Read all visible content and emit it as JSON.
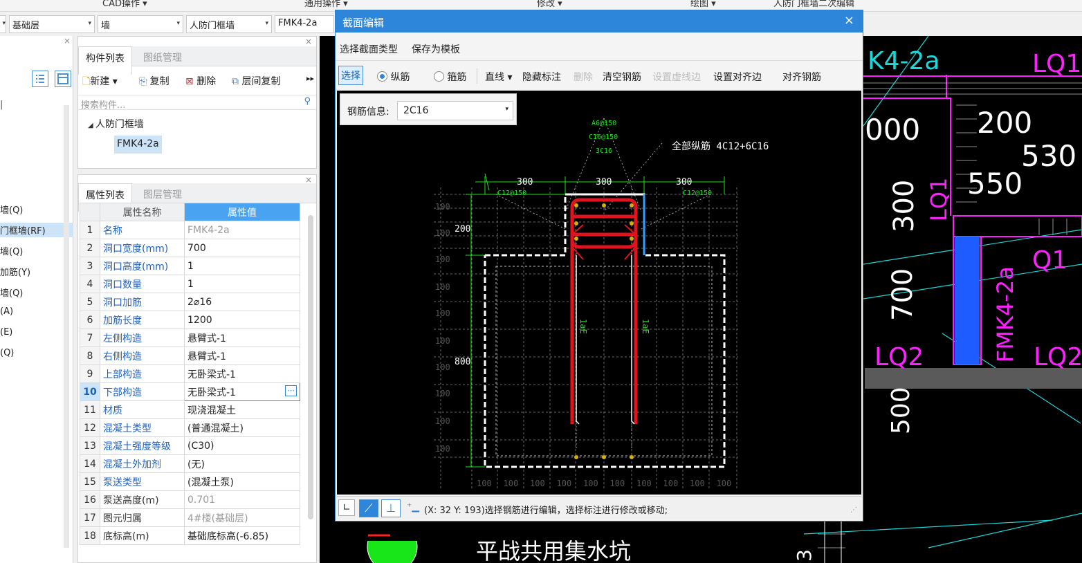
{
  "top_menu": [
    "CAD操作 ▾",
    "通用操作 ▾",
    "修改 ▾",
    "绘图 ▾",
    "人防门框墙二次编辑"
  ],
  "selectors": {
    "floor": "基础层",
    "category": "墙",
    "type": "人防门框墙",
    "component": "FMK4-2a"
  },
  "left_nav": [
    "墙(Q)",
    "门框墙(RF)",
    "墙(Q)",
    "加筋(Y)",
    "墙(Q)",
    "(A)",
    "(E)",
    "(Q)"
  ],
  "component_panel": {
    "tabs": [
      "构件列表",
      "图纸管理"
    ],
    "tools": [
      "新建 ▾",
      "复制",
      "删除",
      "层间复制"
    ],
    "search_placeholder": "搜索构件...",
    "tree_group": "人防门框墙",
    "tree_item": "FMK4-2a"
  },
  "property_panel": {
    "tabs": [
      "属性列表",
      "图层管理"
    ],
    "header_name": "属性名称",
    "header_value": "属性值",
    "rows": [
      {
        "n": "1",
        "name": "名称",
        "value": "FMK4-2a"
      },
      {
        "n": "2",
        "name": "洞口宽度(mm)",
        "value": "700"
      },
      {
        "n": "3",
        "name": "洞口高度(mm)",
        "value": "1"
      },
      {
        "n": "4",
        "name": "洞口数量",
        "value": "1"
      },
      {
        "n": "5",
        "name": "洞口加筋",
        "value": "2⌀16"
      },
      {
        "n": "6",
        "name": "加筋长度",
        "value": "1200"
      },
      {
        "n": "7",
        "name": "左侧构造",
        "value": "悬臂式-1"
      },
      {
        "n": "8",
        "name": "右侧构造",
        "value": "悬臂式-1"
      },
      {
        "n": "9",
        "name": "上部构造",
        "value": "无卧梁式-1"
      },
      {
        "n": "10",
        "name": "下部构造",
        "value": "无卧梁式-1"
      },
      {
        "n": "11",
        "name": "材质",
        "value": "现浇混凝土"
      },
      {
        "n": "12",
        "name": "混凝土类型",
        "value": "(普通混凝土)"
      },
      {
        "n": "13",
        "name": "混凝土强度等级",
        "value": "(C30)"
      },
      {
        "n": "14",
        "name": "混凝土外加剂",
        "value": "(无)"
      },
      {
        "n": "15",
        "name": "泵送类型",
        "value": "(混凝土泵)"
      },
      {
        "n": "16",
        "name": "泵送高度(m)",
        "value": "0.701"
      },
      {
        "n": "17",
        "name": "图元归属",
        "value": "4#楼(基础层)"
      },
      {
        "n": "18",
        "name": "底标高(m)",
        "value": "基础底标高(-6.85)"
      }
    ]
  },
  "dialog": {
    "title": "截面编辑",
    "close": "×",
    "menu": [
      "选择截面类型",
      "保存为模板"
    ],
    "tool_select": "选择",
    "radio_long": "纵筋",
    "radio_stirrup": "箍筋",
    "tools": [
      "直线 ▾",
      "隐藏标注",
      "删除",
      "清空钢筋",
      "设置虚线边",
      "设置对齐边",
      "对齐钢筋"
    ],
    "rebar_info_label": "钢筋信息:",
    "rebar_info_value": "2C16",
    "status": "(X: 32 Y: 193)选择钢筋进行编辑，选择标注进行修改或移动;"
  },
  "drawing": {
    "total_label": "全部纵筋  4C12+6C16",
    "top_labels": [
      "A6@150",
      "C16@150",
      "3C16"
    ],
    "side_label_left": "C12@150",
    "side_label_right": "C12@150",
    "dim_top": [
      "300",
      "300",
      "300"
    ],
    "dim_left_big": [
      "200",
      "800"
    ],
    "dim_left_small": [
      "100",
      "100",
      "100",
      "100",
      "100",
      "100",
      "100",
      "100",
      "100",
      "100"
    ],
    "dim_bottom": [
      "100",
      "100",
      "100",
      "100",
      "100",
      "100",
      "100",
      "100",
      "100",
      "100"
    ],
    "anchor_left": "1aE",
    "anchor_right": "1aE"
  },
  "cad_bg": {
    "labels": [
      "K4-2a",
      "LQ1",
      "000",
      "200",
      "530",
      "550",
      "300",
      "LQ1",
      "Q1",
      "700",
      "FMK4-2a",
      "LQ2",
      "LQ2",
      "500",
      "平战共用集水坑",
      "3"
    ]
  },
  "colors": {
    "title_blue": "#2e86db",
    "header_blue": "#4aa3f0",
    "rebar_red": "#e0141e",
    "dim_green": "#19e619",
    "cad_magenta": "#ff20ff",
    "cad_cyan": "#19d9d9"
  }
}
